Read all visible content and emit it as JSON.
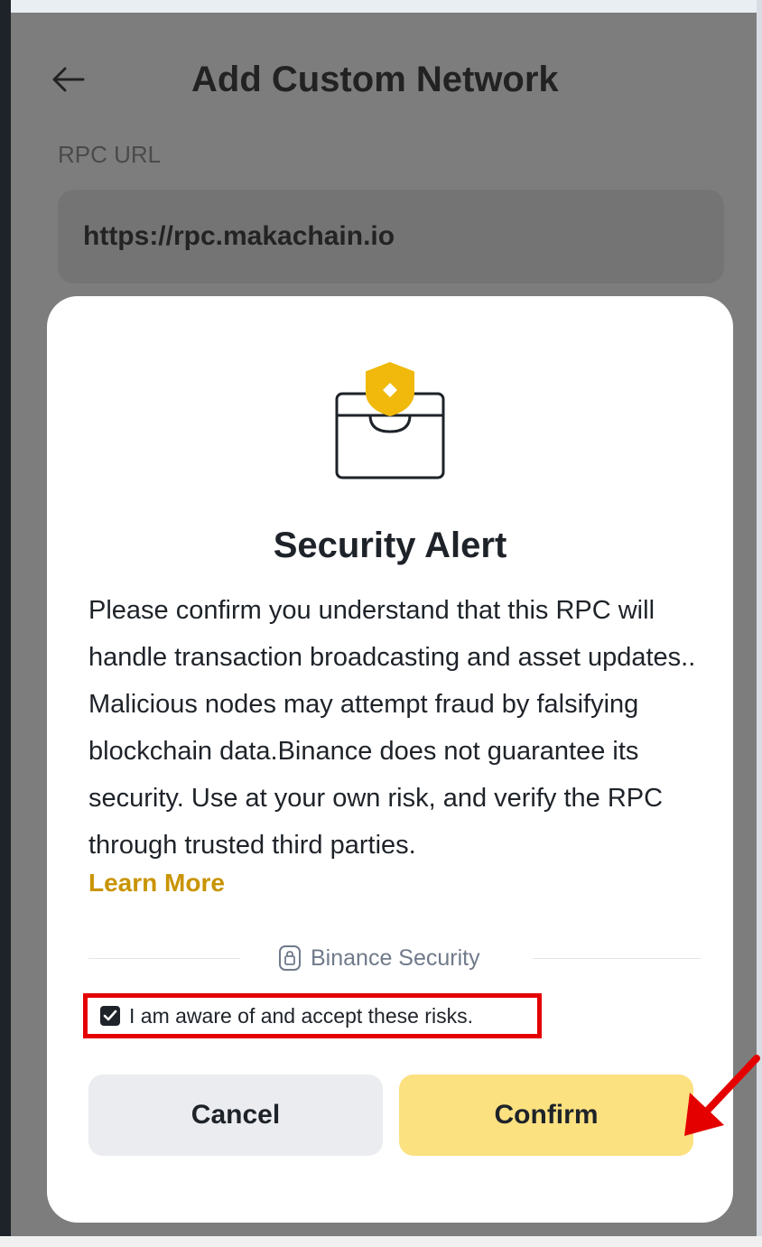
{
  "page": {
    "title": "Add Custom Network"
  },
  "rpc": {
    "label": "RPC URL",
    "value": "https://rpc.makachain.io"
  },
  "modal": {
    "title": "Security Alert",
    "body": "Please confirm you understand that this RPC will handle transaction broadcasting and asset updates.. Malicious nodes may attempt fraud by falsifying blockchain data.Binance does not guarantee its security. Use at your own risk, and verify the RPC through trusted third parties.",
    "learn_more": "Learn More",
    "security_badge": "Binance Security",
    "checkbox_label": "I am aware of and accept these risks.",
    "checkbox_checked": true,
    "cancel_label": "Cancel",
    "confirm_label": "Confirm"
  },
  "icons": {
    "back": "back-arrow-icon",
    "alert": "wallet-shield-icon",
    "badge": "lock-icon",
    "annotation": "red-arrow-annotation"
  },
  "colors": {
    "accent_yellow": "#fce181",
    "link_gold": "#c99400",
    "annotation_red": "#e50000",
    "text_dark": "#1e2329"
  }
}
